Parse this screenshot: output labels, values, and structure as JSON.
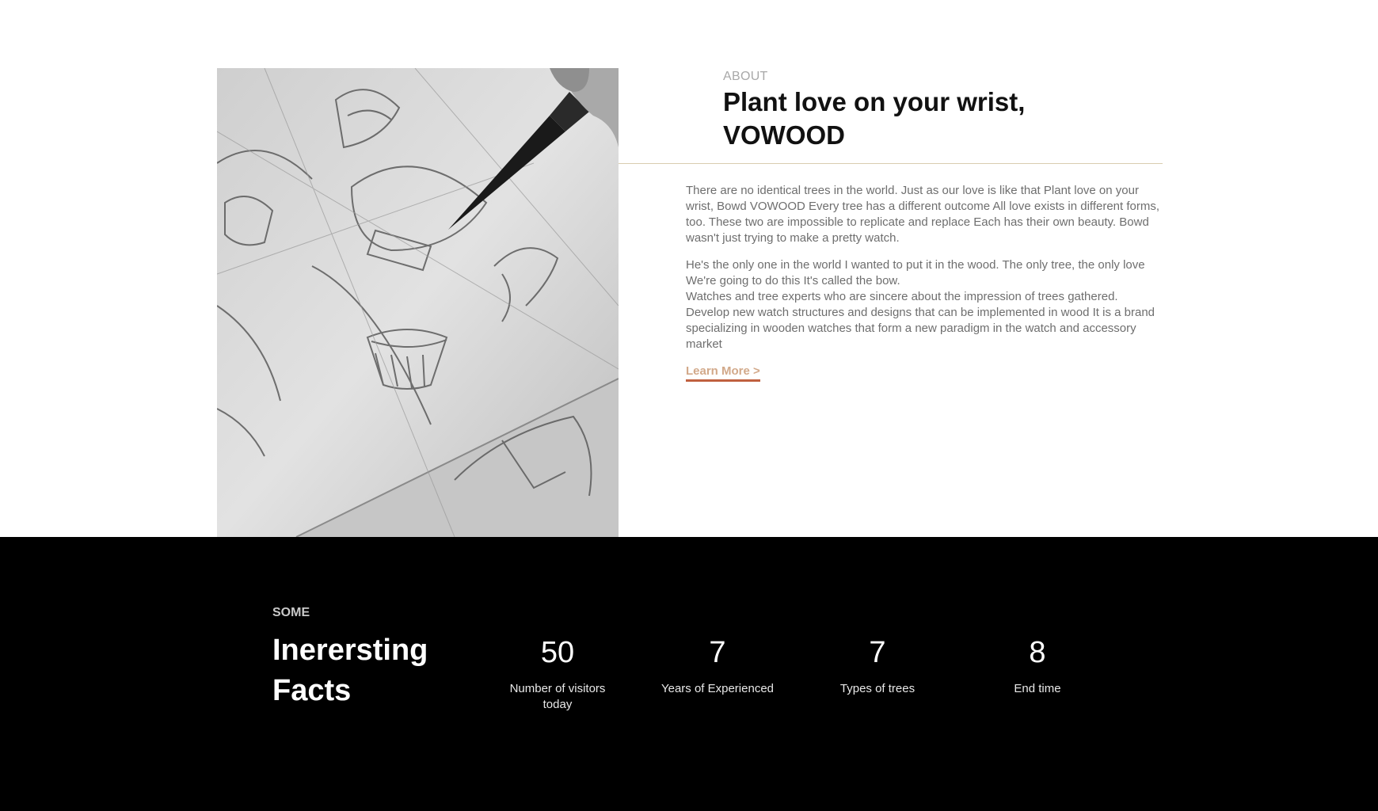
{
  "about": {
    "eyebrow": "ABOUT",
    "title_line1": "Plant love on your wrist,",
    "title_line2": "VOWOOD",
    "paragraph1": "There are no identical trees in the world. Just as our love is like that Plant love on your wrist, Bowd VOWOOD Every tree has a different outcome All love exists in different forms, too. These two are impossible to replicate and replace Each has their own beauty. Bowd wasn't just trying to make a pretty watch.",
    "paragraph2_line1": "He's the only one in the world I wanted to put it in the wood. The only tree, the only love We're going to do this It's called the bow.",
    "paragraph2_line2": "Watches and tree experts who are sincere about the impression of trees gathered. Develop new watch structures and designs that can be implemented in wood It is a brand specializing in wooden watches that form a new paradigm in the watch and accessory market",
    "learn_more": "Learn More >",
    "image": "pencil-sketch-watch-image"
  },
  "facts": {
    "eyebrow": "SOME",
    "title_line1": "Inererst­ing",
    "title_line2": "Facts",
    "stats": [
      {
        "value": "50",
        "label": "Number of visitors today"
      },
      {
        "value": "7",
        "label": "Years of Experienced"
      },
      {
        "value": "7",
        "label": "Types of trees"
      },
      {
        "value": "8",
        "label": "End time"
      }
    ]
  },
  "colors": {
    "accent_underline": "#c0603f",
    "link_text": "#d2a98a",
    "divider": "#d9cdb0",
    "facts_bg": "#000000"
  }
}
